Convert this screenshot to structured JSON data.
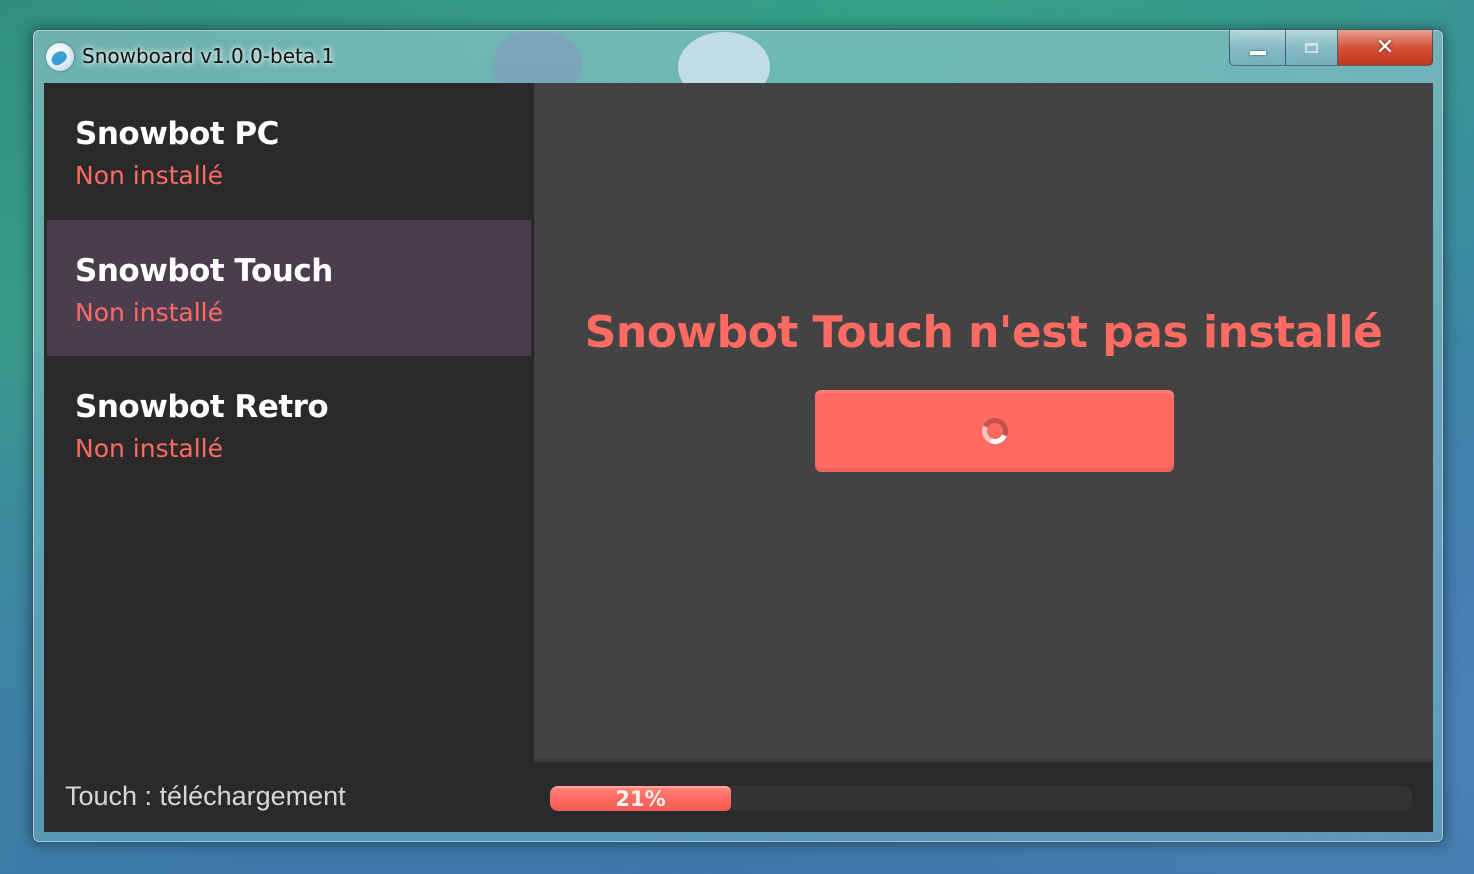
{
  "window": {
    "title": "Snowboard v1.0.0-beta.1",
    "icon": "snowboard-app-icon",
    "controls": {
      "minimize_icon": "minimize-icon",
      "maximize_icon": "maximize-icon",
      "close_label": "✕"
    }
  },
  "sidebar": {
    "items": [
      {
        "name": "Snowbot PC",
        "status": "Non installé",
        "active": false
      },
      {
        "name": "Snowbot Touch",
        "status": "Non installé",
        "active": true
      },
      {
        "name": "Snowbot Retro",
        "status": "Non installé",
        "active": false
      }
    ]
  },
  "main": {
    "message": "Snowbot Touch n'est pas installé",
    "button_state": "loading",
    "button_icon": "spinner-icon"
  },
  "status_bar": {
    "text": "Touch : téléchargement",
    "progress_percent": 21,
    "progress_label": "21%"
  },
  "colors": {
    "accent": "#ff6b63",
    "sidebar_bg": "#2a2a2a",
    "active_item_bg": "#4a3e4e",
    "main_bg": "#434343",
    "text_primary": "#ffffff",
    "status_text": "#d8d8d8"
  }
}
